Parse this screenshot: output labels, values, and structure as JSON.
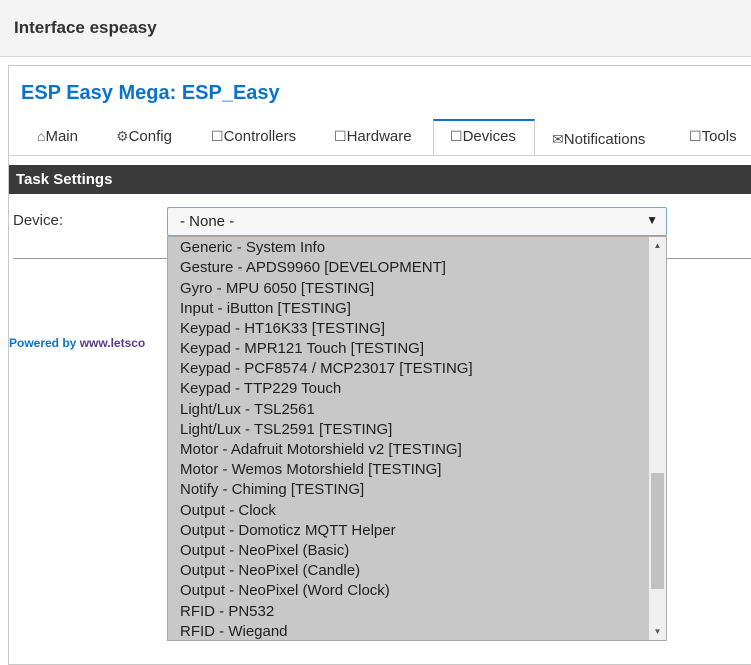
{
  "window": {
    "title": "Interface espeasy"
  },
  "app": {
    "title": "ESP Easy Mega: ESP_Easy"
  },
  "tabs": [
    {
      "icon": "⌂",
      "label": "Main"
    },
    {
      "icon": "⚙",
      "label": "Config"
    },
    {
      "icon": "☐",
      "label": "Controllers"
    },
    {
      "icon": "☐",
      "label": "Hardware"
    },
    {
      "icon": "☐",
      "label": "Devices"
    },
    {
      "icon": "✉",
      "label": "Notifications"
    },
    {
      "icon": "☐",
      "label": "Tools"
    }
  ],
  "active_tab": "Devices",
  "section": {
    "title": "Task Settings"
  },
  "device": {
    "label": "Device:",
    "selected": "- None -",
    "options": [
      "Generic - System Info",
      "Gesture - APDS9960 [DEVELOPMENT]",
      "Gyro - MPU 6050 [TESTING]",
      "Input - iButton [TESTING]",
      "Keypad - HT16K33 [TESTING]",
      "Keypad - MPR121 Touch [TESTING]",
      "Keypad - PCF8574 / MCP23017 [TESTING]",
      "Keypad - TTP229 Touch",
      "Light/Lux - TSL2561",
      "Light/Lux - TSL2591 [TESTING]",
      "Motor - Adafruit Motorshield v2 [TESTING]",
      "Motor - Wemos Motorshield [TESTING]",
      "Notify - Chiming [TESTING]",
      "Output - Clock",
      "Output - Domoticz MQTT Helper",
      "Output - NeoPixel (Basic)",
      "Output - NeoPixel (Candle)",
      "Output - NeoPixel (Word Clock)",
      "RFID - PN532",
      "RFID - Wiegand"
    ]
  },
  "footer": {
    "powered_prefix": "Powered by ",
    "powered_link": "www.letsco"
  },
  "colors": {
    "accent": "#0b73c9",
    "section_bar": "#3a3a3a",
    "dropdown_bg": "#c8c8c8"
  }
}
